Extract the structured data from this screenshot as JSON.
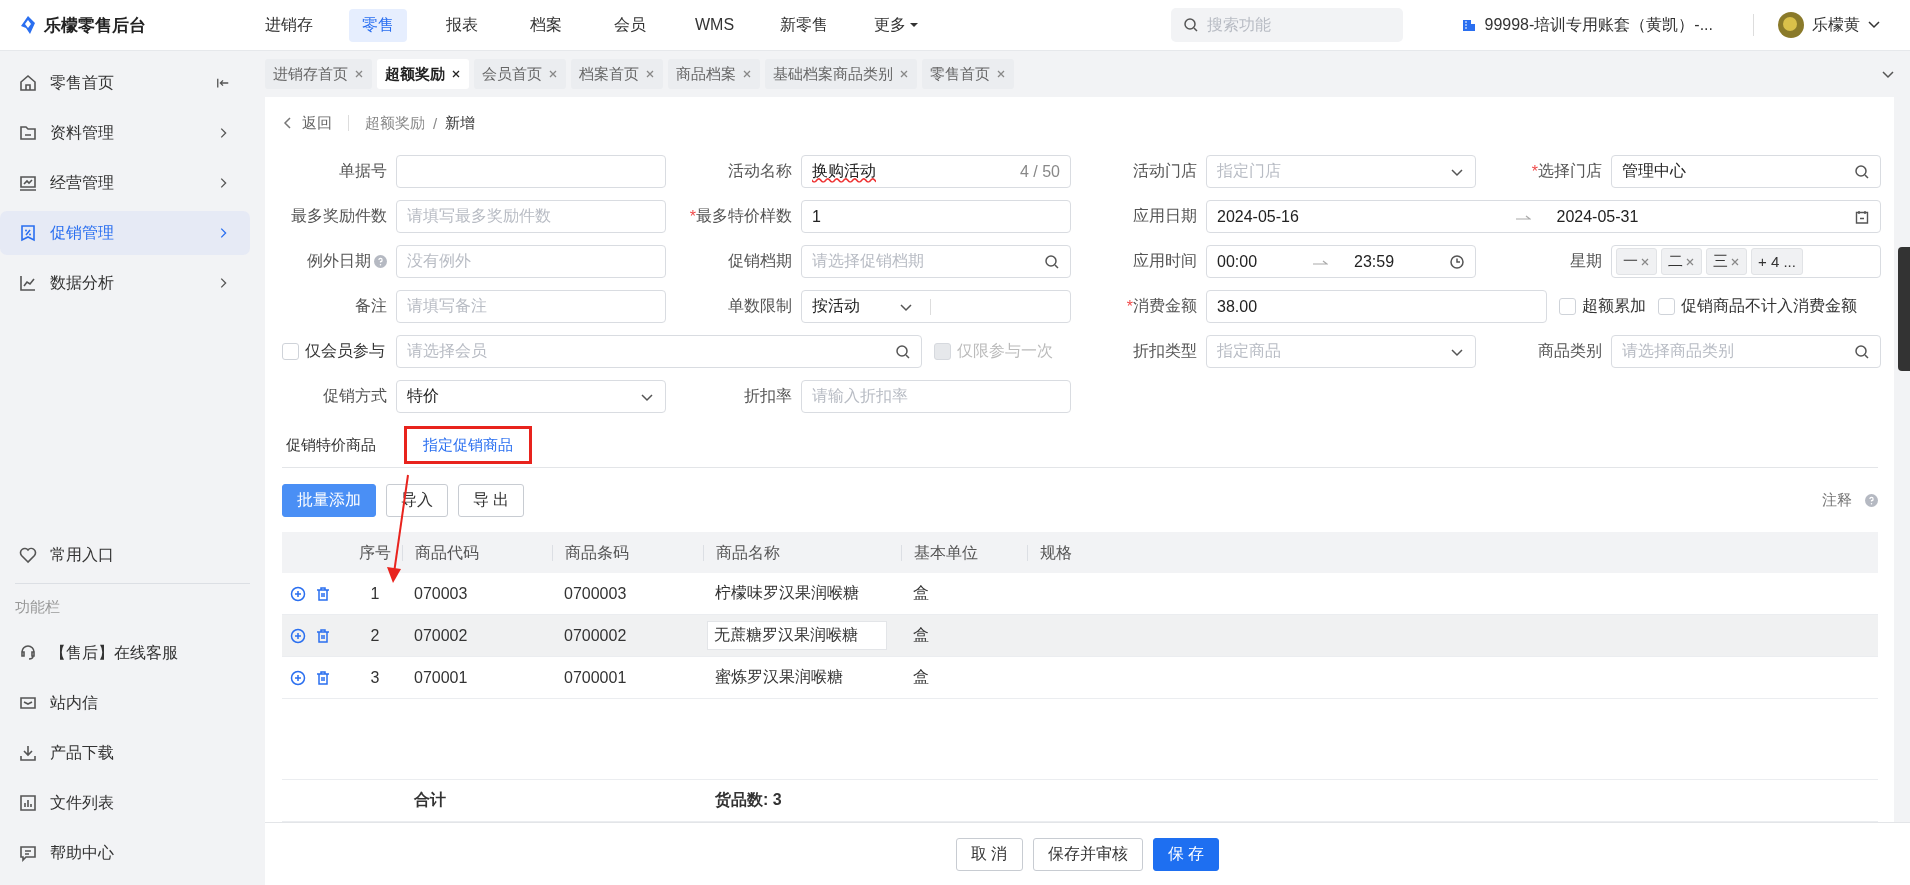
{
  "app": {
    "logo": "乐檬零售后台"
  },
  "nav": [
    {
      "label": "进销存",
      "selected": false,
      "menu": false
    },
    {
      "label": "零售",
      "selected": true,
      "menu": false
    },
    {
      "label": "报表",
      "selected": false,
      "menu": false
    },
    {
      "label": "档案",
      "selected": false,
      "menu": false
    },
    {
      "label": "会员",
      "selected": false,
      "menu": false
    },
    {
      "label": "WMS",
      "selected": false,
      "menu": false
    },
    {
      "label": "新零售",
      "selected": false,
      "menu": false
    },
    {
      "label": "更多",
      "selected": false,
      "menu": true
    }
  ],
  "search": {
    "placeholder": "搜索功能"
  },
  "account": {
    "name": "99998-培训专用账套（黄凯）-..."
  },
  "user": {
    "name": "乐檬黄"
  },
  "sidebar": {
    "items": [
      {
        "label": "零售首页",
        "selected": false
      },
      {
        "label": "资料管理",
        "selected": false
      },
      {
        "label": "经营管理",
        "selected": false
      },
      {
        "label": "促销管理",
        "selected": true
      },
      {
        "label": "数据分析",
        "selected": false
      }
    ],
    "shortcut": "常用入口",
    "function_title": "功能栏",
    "functions": [
      "【售后】在线客服",
      "站内信",
      "产品下载",
      "文件列表",
      "帮助中心"
    ]
  },
  "tabs": [
    {
      "label": "进销存首页",
      "selected": false
    },
    {
      "label": "超额奖励",
      "selected": true
    },
    {
      "label": "会员首页",
      "selected": false
    },
    {
      "label": "档案首页",
      "selected": false
    },
    {
      "label": "商品档案",
      "selected": false
    },
    {
      "label": "基础档案商品类别",
      "selected": false
    },
    {
      "label": "零售首页",
      "selected": false
    }
  ],
  "breadcrumb": {
    "back": "返回",
    "path": [
      "超额奖励",
      "新增"
    ],
    "separator": "/"
  },
  "form": {
    "required_mark": "*",
    "rows": [
      [
        {
          "kind": "input",
          "label": "单据号",
          "required": false
        },
        {
          "kind": "input",
          "label": "活动名称",
          "required": false,
          "value": "换购活动",
          "counter": "4 / 50",
          "misspelled": true
        },
        {
          "kind": "select",
          "label": "活动门店",
          "required": false,
          "placeholder": "指定门店"
        },
        {
          "kind": "search",
          "label": "选择门店",
          "required": true,
          "value": "管理中心"
        }
      ],
      [
        {
          "kind": "input",
          "label": "最多奖励件数",
          "required": false,
          "placeholder": "请填写最多奖励件数"
        },
        {
          "kind": "input",
          "label": "最多特价样数",
          "required": true,
          "value": "1"
        },
        {
          "kind": "date_range",
          "label": "应用日期",
          "required": false,
          "start": "2024-05-16",
          "end": "2024-05-31"
        }
      ],
      [
        {
          "kind": "input",
          "label": "例外日期",
          "required": false,
          "help": true,
          "placeholder": "没有例外"
        },
        {
          "kind": "search",
          "label": "促销档期",
          "required": false,
          "placeholder": "请选择促销档期"
        },
        {
          "kind": "time_range",
          "label": "应用时间",
          "required": false,
          "start": "00:00",
          "end": "23:59"
        },
        {
          "kind": "tags",
          "label": "星期",
          "required": false,
          "tags": [
            "一",
            "二",
            "三"
          ],
          "more": "+ 4 ..."
        }
      ],
      [
        {
          "kind": "input",
          "label": "备注",
          "required": false,
          "placeholder": "请填写备注"
        },
        {
          "kind": "select_input",
          "label": "单数限制",
          "required": false,
          "value": "按活动"
        },
        {
          "kind": "input",
          "label": "消费金额",
          "required": true,
          "value": "38.00"
        },
        {
          "kind": "checkbox",
          "label": "超额累加",
          "checked": false,
          "disabled": false
        },
        {
          "kind": "checkbox",
          "label": "促销商品不计入消费金额",
          "checked": false,
          "disabled": false
        }
      ],
      [
        {
          "kind": "search",
          "check_label": "仅会员参与",
          "checked": false,
          "placeholder": "请选择会员"
        },
        {
          "kind": "checkbox",
          "label": "仅限参与一次",
          "checked": false,
          "disabled": true
        },
        {
          "kind": "select",
          "label": "折扣类型",
          "required": false,
          "placeholder": "指定商品"
        },
        {
          "kind": "search",
          "label": "商品类别",
          "required": false,
          "placeholder": "请选择商品类别"
        }
      ],
      [
        {
          "kind": "select",
          "label": "促销方式",
          "required": false,
          "value": "特价"
        },
        {
          "kind": "input",
          "label": "折扣率",
          "required": false,
          "placeholder": "请输入折扣率"
        }
      ]
    ]
  },
  "product_tabs": [
    {
      "label": "促销特价商品",
      "selected": false
    },
    {
      "label": "指定促销商品",
      "selected": true
    }
  ],
  "toolbar": {
    "buttons": [
      {
        "label": "批量添加",
        "primary": true
      },
      {
        "label": "导入",
        "primary": false
      },
      {
        "label": "导 出",
        "primary": false
      }
    ],
    "note": "注释"
  },
  "table": {
    "columns": [
      "序号",
      "商品代码",
      "商品条码",
      "商品名称",
      "基本单位",
      "规格"
    ],
    "rows": [
      {
        "index": "1",
        "code": "070003",
        "barcode": "0700003",
        "name": "柠檬味罗汉果润喉糖",
        "unit": "盒",
        "selected": false
      },
      {
        "index": "2",
        "code": "070002",
        "barcode": "0700002",
        "name": "无蔗糖罗汉果润喉糖",
        "unit": "盒",
        "selected": true
      },
      {
        "index": "3",
        "code": "070001",
        "barcode": "0700001",
        "name": "蜜炼罗汉果润喉糖",
        "unit": "盒",
        "selected": false
      }
    ],
    "totals": {
      "label": "合计",
      "count": "货品数: 3"
    }
  },
  "footer": {
    "buttons": [
      {
        "label": "取 消",
        "primary": false
      },
      {
        "label": "保存并审核",
        "primary": false
      },
      {
        "label": "保 存",
        "primary": true
      }
    ]
  }
}
